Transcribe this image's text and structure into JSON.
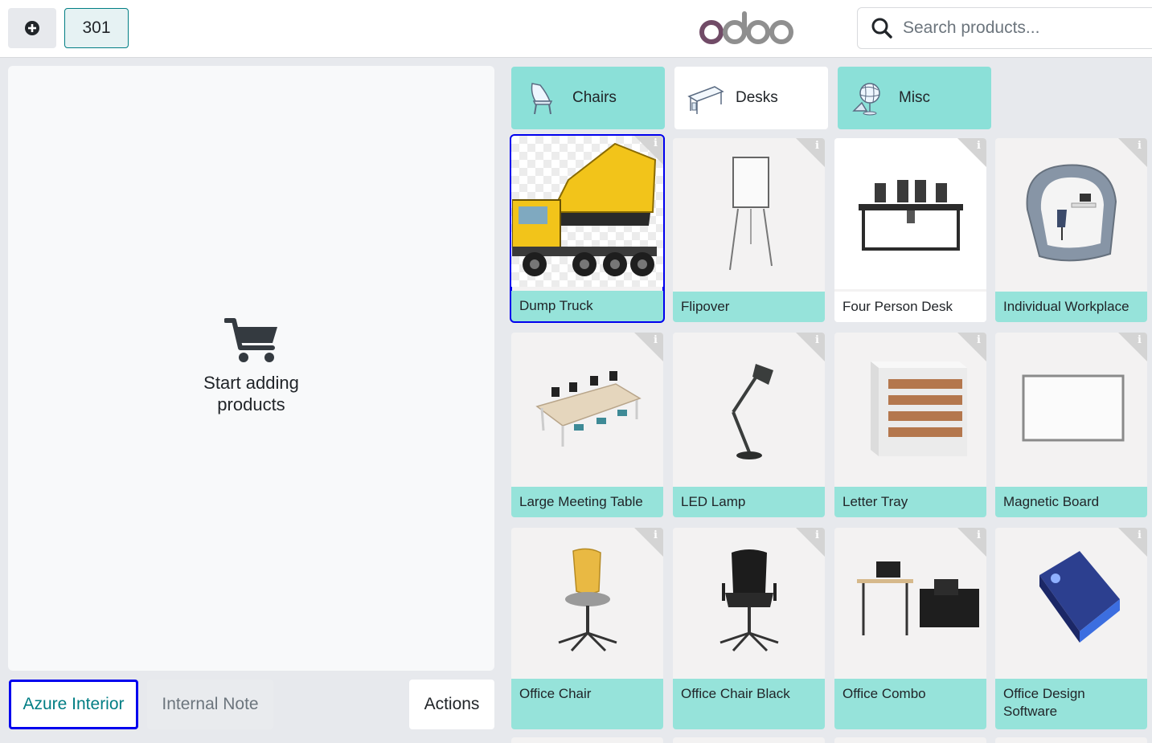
{
  "header": {
    "add_button_icon": "plus-circle-icon",
    "table_number": "301",
    "logo_text": "odoo",
    "search_placeholder": "Search products..."
  },
  "order": {
    "empty_message": "Start adding products",
    "empty_icon": "cart-icon",
    "customer_button": "Azure Interior",
    "note_button": "Internal Note",
    "actions_button": "Actions"
  },
  "categories": [
    {
      "label": "Chairs",
      "icon": "chair-icon",
      "active": true
    },
    {
      "label": "Desks",
      "icon": "desk-icon",
      "active": false
    },
    {
      "label": "Misc",
      "icon": "misc-icon",
      "active": true
    }
  ],
  "products": [
    {
      "name": "Dump Truck",
      "selected": true
    },
    {
      "name": "Flipover"
    },
    {
      "name": "Four Person Desk"
    },
    {
      "name": "Individual Workplace"
    },
    {
      "name": "Large Meeting Table"
    },
    {
      "name": "LED Lamp"
    },
    {
      "name": "Letter Tray"
    },
    {
      "name": "Magnetic Board"
    },
    {
      "name": "Office Chair"
    },
    {
      "name": "Office Chair Black"
    },
    {
      "name": "Office Combo"
    },
    {
      "name": "Office Design Software"
    }
  ],
  "colors": {
    "accent": "#017e84",
    "card_label": "#96e3da",
    "category_active": "#8be0d8",
    "selection_outline": "#0000ee"
  }
}
